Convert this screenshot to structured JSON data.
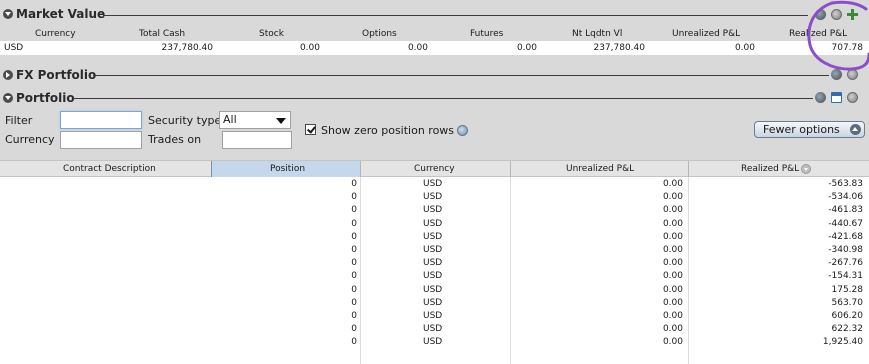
{
  "market_value": {
    "title": "Market Value",
    "columns": [
      "Currency",
      "Total Cash",
      "Stock",
      "Options",
      "Futures",
      "Nt Lqdtn Vl",
      "Unrealized P&L",
      "Realized P&L"
    ],
    "row": [
      "USD",
      "237,780.40",
      "0.00",
      "0.00",
      "0.00",
      "237,780.40",
      "0.00",
      "707.78"
    ]
  },
  "fx_portfolio": {
    "title": "FX Portfolio"
  },
  "portfolio": {
    "title": "Portfolio",
    "filter_label": "Filter",
    "filter_value": "",
    "security_type_label": "Security type",
    "security_type_value": "All",
    "currency_label": "Currency",
    "currency_value": "",
    "trades_on_label": "Trades on",
    "trades_on_value": "",
    "show_zero_label": "Show zero position rows",
    "show_zero_checked": true,
    "fewer_options_label": "Fewer options",
    "columns": [
      "Contract Description",
      "Position",
      "Currency",
      "Unrealized P&L",
      "Realized P&L"
    ],
    "rows": [
      {
        "description": "",
        "position": "0",
        "currency": "USD",
        "unrealized": "0.00",
        "realized": "-563.83"
      },
      {
        "description": "",
        "position": "0",
        "currency": "USD",
        "unrealized": "0.00",
        "realized": "-534.06"
      },
      {
        "description": "",
        "position": "0",
        "currency": "USD",
        "unrealized": "0.00",
        "realized": "-461.83"
      },
      {
        "description": "",
        "position": "0",
        "currency": "USD",
        "unrealized": "0.00",
        "realized": "-440.67"
      },
      {
        "description": "",
        "position": "0",
        "currency": "USD",
        "unrealized": "0.00",
        "realized": "-421.68"
      },
      {
        "description": "",
        "position": "0",
        "currency": "USD",
        "unrealized": "0.00",
        "realized": "-340.98"
      },
      {
        "description": "",
        "position": "0",
        "currency": "USD",
        "unrealized": "0.00",
        "realized": "-267.76"
      },
      {
        "description": "",
        "position": "0",
        "currency": "USD",
        "unrealized": "0.00",
        "realized": "-154.31"
      },
      {
        "description": "",
        "position": "0",
        "currency": "USD",
        "unrealized": "0.00",
        "realized": "175.28"
      },
      {
        "description": "",
        "position": "0",
        "currency": "USD",
        "unrealized": "0.00",
        "realized": "563.70"
      },
      {
        "description": "",
        "position": "0",
        "currency": "USD",
        "unrealized": "0.00",
        "realized": "606.20"
      },
      {
        "description": "",
        "position": "0",
        "currency": "USD",
        "unrealized": "0.00",
        "realized": "622.32"
      },
      {
        "description": "",
        "position": "0",
        "currency": "USD",
        "unrealized": "0.00",
        "realized": "1,925.40"
      }
    ]
  },
  "icons": {
    "collapse": "chevron-down-icon",
    "gear": "gear-icon",
    "close": "close-icon",
    "add": "plus-icon",
    "window": "window-icon",
    "help": "help-icon",
    "sort": "sort-icon",
    "fewer_options": "chevron-up-icon"
  },
  "colors": {
    "background": "#d9d9d9",
    "selected_column": "#c5d7ea",
    "annotation": "#8a4fc8",
    "add_icon": "#3b8a3b"
  }
}
